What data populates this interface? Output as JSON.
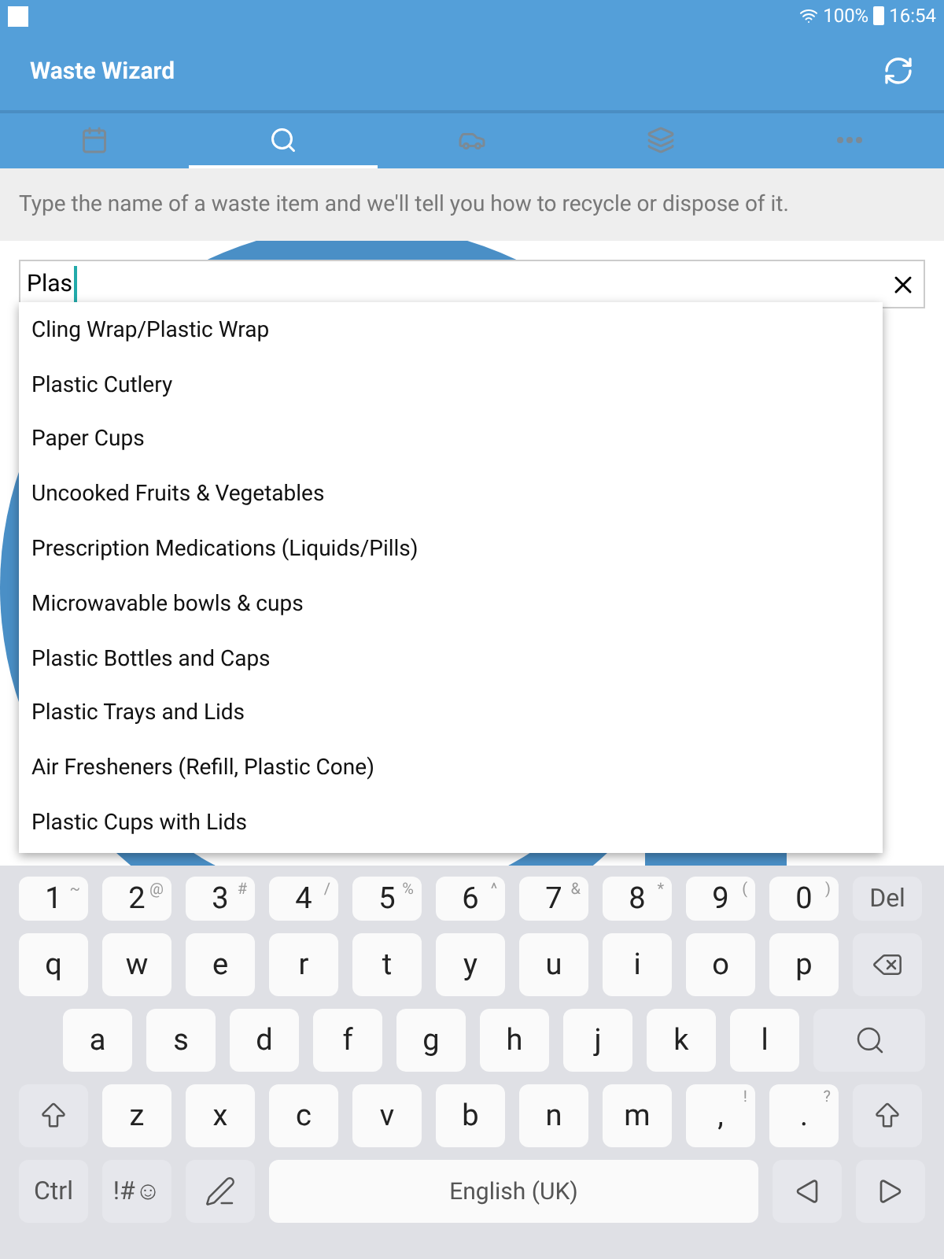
{
  "status_bar": {
    "battery": "100%",
    "time": "16:54"
  },
  "app_bar": {
    "title": "Waste Wizard"
  },
  "tabs": [
    {
      "kind": "calendar",
      "selected": false
    },
    {
      "kind": "search",
      "selected": true
    },
    {
      "kind": "vehicle",
      "selected": false
    },
    {
      "kind": "stack",
      "selected": false
    },
    {
      "kind": "more",
      "selected": false
    }
  ],
  "description": "Type the name of a waste item and we'll tell you how to recycle or dispose of it.",
  "search": {
    "value": "Plas"
  },
  "suggestions": [
    "Cling Wrap/Plastic Wrap",
    "Plastic Cutlery",
    "Paper Cups",
    "Uncooked Fruits & Vegetables",
    "Prescription Medications (Liquids/Pills)",
    "Microwavable bowls & cups",
    "Plastic Bottles and Caps",
    "Plastic Trays and Lids",
    "Air Fresheners (Refill, Plastic Cone)",
    "Plastic Cups with Lids"
  ],
  "keyboard": {
    "number_row": [
      {
        "kind": "char",
        "label": "1",
        "alt": "~"
      },
      {
        "kind": "char",
        "label": "2",
        "alt": "@"
      },
      {
        "kind": "char",
        "label": "3",
        "alt": "#"
      },
      {
        "kind": "char",
        "label": "4",
        "alt": "/"
      },
      {
        "kind": "char",
        "label": "5",
        "alt": "%"
      },
      {
        "kind": "char",
        "label": "6",
        "alt": "^"
      },
      {
        "kind": "char",
        "label": "7",
        "alt": "&"
      },
      {
        "kind": "char",
        "label": "8",
        "alt": "*"
      },
      {
        "kind": "char",
        "label": "9",
        "alt": "("
      },
      {
        "kind": "char",
        "label": "0",
        "alt": ")"
      },
      {
        "kind": "func",
        "label": "Del"
      }
    ],
    "upper_letter_row": [
      {
        "kind": "char",
        "label": "q"
      },
      {
        "kind": "char",
        "label": "w"
      },
      {
        "kind": "char",
        "label": "e"
      },
      {
        "kind": "char",
        "label": "r"
      },
      {
        "kind": "char",
        "label": "t"
      },
      {
        "kind": "char",
        "label": "y"
      },
      {
        "kind": "char",
        "label": "u"
      },
      {
        "kind": "char",
        "label": "i"
      },
      {
        "kind": "char",
        "label": "o"
      },
      {
        "kind": "char",
        "label": "p"
      },
      {
        "kind": "backspace"
      }
    ],
    "middle_letter_row": [
      {
        "kind": "char",
        "label": "a"
      },
      {
        "kind": "char",
        "label": "s"
      },
      {
        "kind": "char",
        "label": "d"
      },
      {
        "kind": "char",
        "label": "f"
      },
      {
        "kind": "char",
        "label": "g"
      },
      {
        "kind": "char",
        "label": "h"
      },
      {
        "kind": "char",
        "label": "j"
      },
      {
        "kind": "char",
        "label": "k"
      },
      {
        "kind": "char",
        "label": "l"
      },
      {
        "kind": "search"
      }
    ],
    "lower_letter_row": [
      {
        "kind": "shift"
      },
      {
        "kind": "char",
        "label": "z"
      },
      {
        "kind": "char",
        "label": "x"
      },
      {
        "kind": "char",
        "label": "c"
      },
      {
        "kind": "char",
        "label": "v"
      },
      {
        "kind": "char",
        "label": "b"
      },
      {
        "kind": "char",
        "label": "n"
      },
      {
        "kind": "char",
        "label": "m"
      },
      {
        "kind": "char",
        "label": ",",
        "alt": "!"
      },
      {
        "kind": "char",
        "label": ".",
        "alt": "?"
      },
      {
        "kind": "shift"
      }
    ],
    "bottom_row": [
      {
        "kind": "func",
        "label": "Ctrl"
      },
      {
        "kind": "func",
        "label": "!#☺"
      },
      {
        "kind": "pen"
      },
      {
        "kind": "space",
        "label": "English (UK)"
      },
      {
        "kind": "left"
      },
      {
        "kind": "right"
      }
    ]
  }
}
